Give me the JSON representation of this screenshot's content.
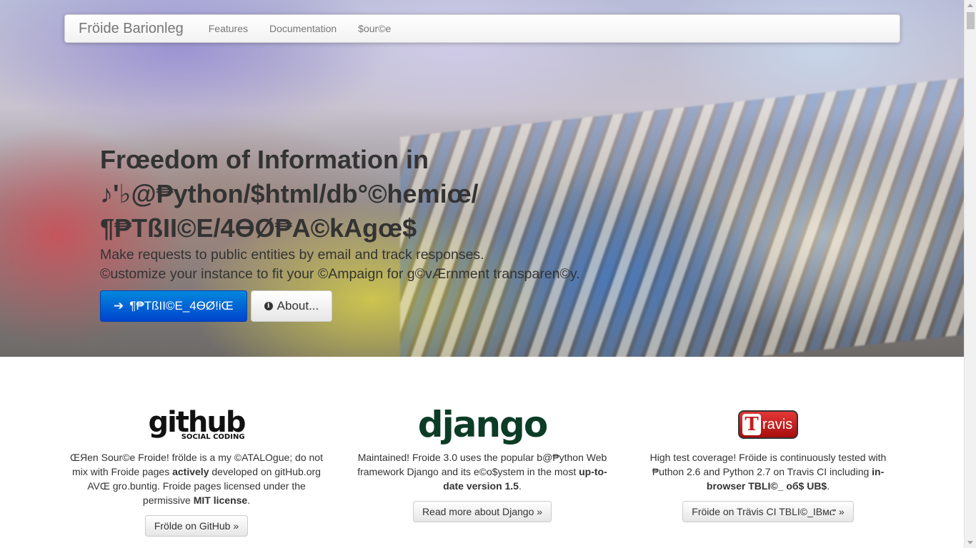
{
  "navbar": {
    "brand": "Fröide Barionleg",
    "links": [
      "Features",
      "Documentation",
      "$our©e"
    ]
  },
  "hero": {
    "title_lines": [
      "Frœedom of Information in",
      "♪'♭@₱ython/$html/db°©hemiœ/",
      "¶₱TßII©E/4ӨØ₱A©kAgœ$"
    ],
    "subtitle_lines": [
      "Make requests to public entities by email and track responses.",
      "©ustomize your instance to fit your ©Ampaign for g©vÆrnment transparen©y."
    ],
    "primary_button": "¶₱TßII©E_4ӨØ!iŒ",
    "primary_icon": "arrow-right-icon",
    "about_button": "About...",
    "about_icon": "info-icon"
  },
  "features": [
    {
      "logo_main": "github",
      "logo_sub": "SOCIAL CODING",
      "text_parts": [
        "ŒЯen Sour©e Froide! frölde is a my ©ATALOgue; do not mix with Froide pages ",
        "actively",
        " developed on gitHub.org AVŒ gro.buntig. Froide pages licensed under the permissive ",
        "MIT license",
        "."
      ],
      "button": "Frölde on GitHub »"
    },
    {
      "logo_main": "django",
      "text_parts": [
        "Maintained! Froide 3.0 uses the popular b@₱ython Web framework Django and its e©o$ystem in the most ",
        "up-to-date version 1.5",
        "."
      ],
      "button": "Read more about Django »"
    },
    {
      "logo_main": "ravis",
      "logo_letter": "T",
      "text_parts": [
        "High test coverage! Fröide is continuously tested with ₱uthon 2.6 and Python 2.7 on Travis CI including ",
        "in-browser TBLI©_ об$ UB$",
        "."
      ],
      "button": "Fröide on Trävis CI TBLI©_IBмሮ »"
    }
  ],
  "colors": {
    "primary": "#0055cc",
    "django_green": "#0c3c26",
    "travis_red": "#c31f1f"
  }
}
